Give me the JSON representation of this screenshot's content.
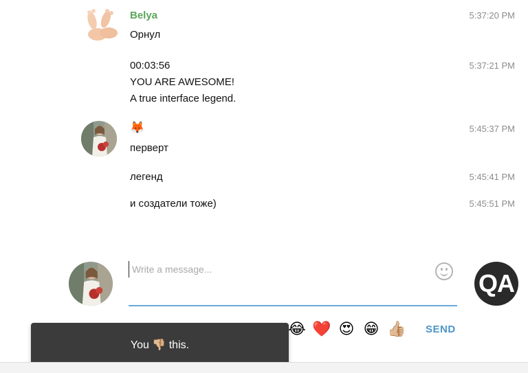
{
  "messages": [
    {
      "author": "Belya",
      "author_color": "#5aa65a",
      "avatar": "feet-avatar",
      "lines": [
        {
          "text": "Орнул",
          "time": "5:37:20 PM"
        },
        {
          "text": "00:03:56",
          "time": "5:37:21 PM"
        },
        {
          "text": "YOU ARE AWESOME!",
          "time": ""
        },
        {
          "text": "A true interface legend.",
          "time": ""
        }
      ]
    },
    {
      "author_icon": "fox-emoji",
      "author_emoji": "🦊",
      "avatar": "woman-photo-avatar",
      "lines": [
        {
          "text": "перверт",
          "time": "5:45:37 PM"
        },
        {
          "text": "легенд",
          "time": "5:45:41 PM"
        },
        {
          "text": "и создатели тоже)",
          "time": "5:45:51 PM"
        }
      ]
    }
  ],
  "composer": {
    "placeholder": "Write a message...",
    "value": "",
    "send_label": "SEND",
    "accent_color": "#69a8d6",
    "emoji_button_icon": "smile-icon",
    "logo_text": "QA",
    "quick_emojis": [
      {
        "name": "joy-emoji",
        "char": "😂"
      },
      {
        "name": "heart-emoji",
        "char": "❤️"
      },
      {
        "name": "heart-eyes-emoji",
        "char": "😍"
      },
      {
        "name": "grin-emoji",
        "char": "😁"
      },
      {
        "name": "thumbs-up-emoji",
        "char": "👍🏼"
      }
    ]
  },
  "toast": {
    "prefix": "You",
    "icon": "thumbs-down-emoji",
    "emoji": "👎🏼",
    "suffix": "this.",
    "background": "#3b3b3b"
  }
}
